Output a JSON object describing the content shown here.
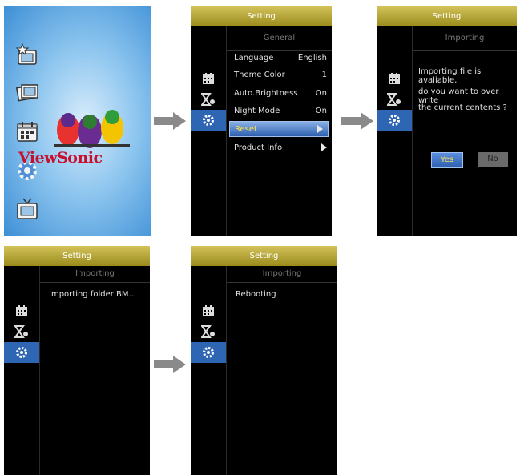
{
  "home": {
    "brand": "ViewSonic"
  },
  "panel2": {
    "title": "Setting",
    "subtitle": "General",
    "rows": [
      {
        "label": "Language",
        "value": "English"
      },
      {
        "label": "Theme Color",
        "value": "1"
      },
      {
        "label": "Auto.Brightness",
        "value": "On"
      },
      {
        "label": "Night Mode",
        "value": "On"
      }
    ],
    "reset_label": "Reset",
    "product_info_label": "Product Info"
  },
  "panel3": {
    "title": "Setting",
    "subtitle": "Importing",
    "line1": "Importing file is avaliable,",
    "line2": "do you want to over write",
    "line3": "the current centents ?",
    "yes_label": "Yes",
    "no_label": "No"
  },
  "panel4": {
    "title": "Setting",
    "subtitle": "Importing",
    "message": "Importing folder BM..."
  },
  "panel5": {
    "title": "Setting",
    "subtitle": "Importing",
    "message": "Rebooting"
  },
  "icons": {
    "sidebar": [
      "calendar-icon",
      "hourglass-icon",
      "gear-icon"
    ],
    "home": [
      "star-photo-icon",
      "photos-icon",
      "calendar-icon",
      "gear-icon",
      "tv-icon"
    ]
  },
  "colors": {
    "header": "#b8a834",
    "active": "#2f66b3",
    "arrow": "#8a8a8a",
    "yes": "#3a6fc4",
    "no": "#6a6a6a"
  }
}
